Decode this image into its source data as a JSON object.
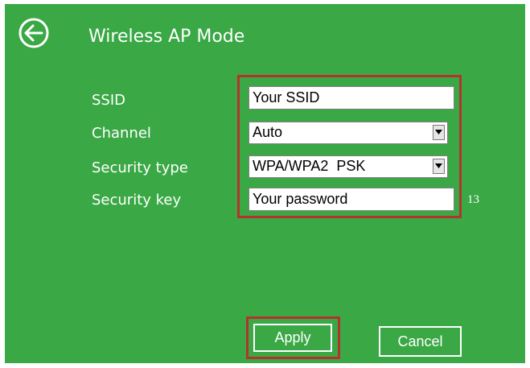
{
  "colors": {
    "background": "#3aa845",
    "text": "#ffffff",
    "highlight": "#b5332e",
    "field_bg": "#ffffff"
  },
  "header": {
    "back_icon": "back-arrow-circle-icon",
    "title": "Wireless AP Mode"
  },
  "form": {
    "ssid": {
      "label": "SSID",
      "value": "Your SSID"
    },
    "channel": {
      "label": "Channel",
      "value": "Auto"
    },
    "security_type": {
      "label": "Security type",
      "value": "WPA/WPA2  PSK"
    },
    "security_key": {
      "label": "Security key",
      "value": "Your password",
      "length": "13"
    }
  },
  "buttons": {
    "apply": "Apply",
    "cancel": "Cancel"
  }
}
